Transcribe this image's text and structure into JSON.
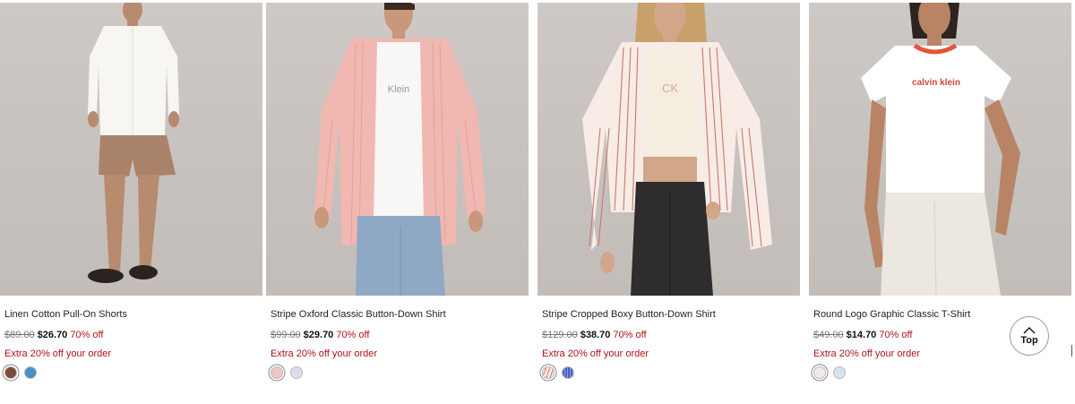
{
  "products": [
    {
      "name": "Linen Cotton Pull-On Shorts",
      "original_price": "$89.00",
      "sale_price": "$26.70",
      "discount": "70% off",
      "promo": "Extra 20% off your order",
      "swatch_colors": [
        "#7a4b3a",
        "#4a90c8"
      ]
    },
    {
      "name": "Stripe Oxford Classic Button-Down Shirt",
      "original_price": "$99.00",
      "sale_price": "$29.70",
      "discount": "70% off",
      "promo": "Extra 20% off your order",
      "swatch_colors": [
        "#f2c4c4",
        "#dcdcf0"
      ]
    },
    {
      "name": "Stripe Cropped Boxy Button-Down Shirt",
      "original_price": "$129.00",
      "sale_price": "$38.70",
      "discount": "70% off",
      "promo": "Extra 20% off your order",
      "swatch_colors": [
        "#f3e6e0",
        "#4a5fc0"
      ]
    },
    {
      "name": "Round Logo Graphic Classic T-Shirt",
      "original_price": "$49.00",
      "sale_price": "$14.70",
      "discount": "70% off",
      "promo": "Extra 20% off your order",
      "swatch_colors": [
        "#f0e8ee",
        "#d6e2ef"
      ]
    }
  ],
  "back_to_top": {
    "label": "Top",
    "icon": "chevron-up-icon"
  },
  "colors": {
    "sale_red": "#b0121b",
    "photo_background": "#c9c3c0"
  }
}
